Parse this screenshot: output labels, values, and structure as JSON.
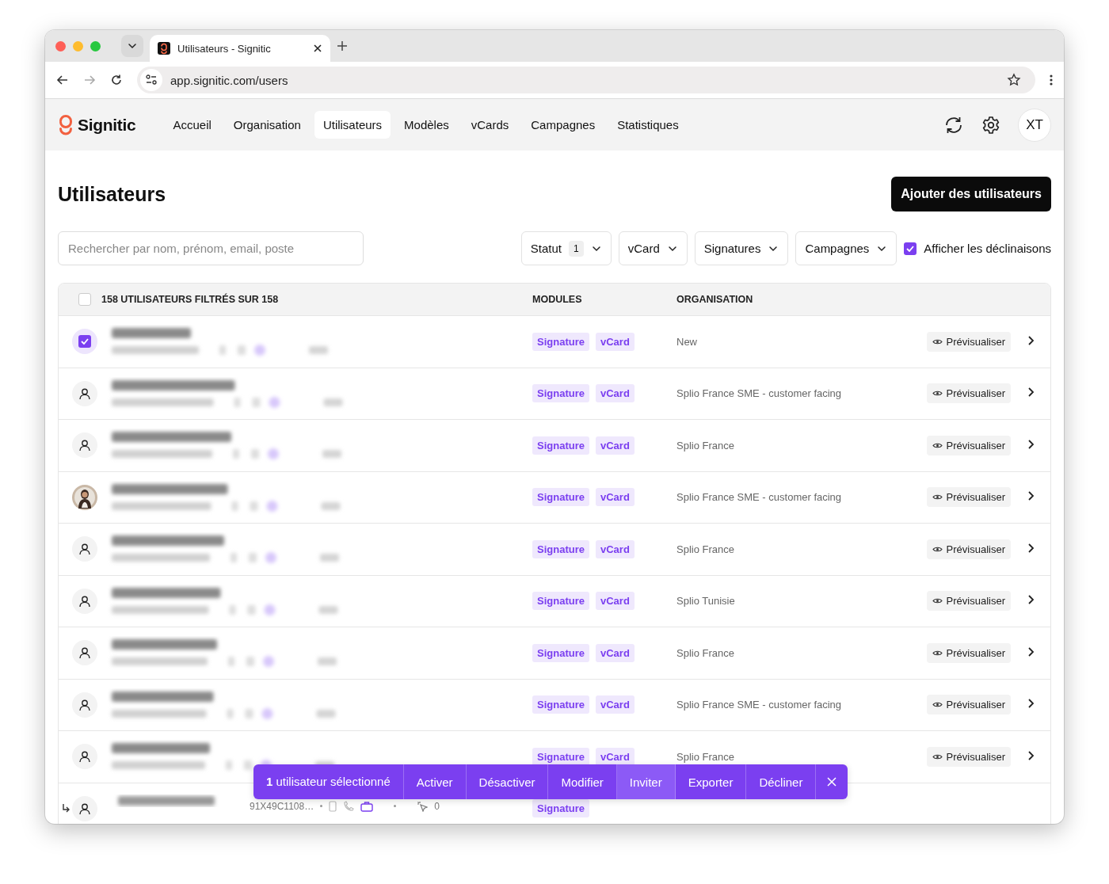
{
  "browser": {
    "tab_title": "Utilisateurs - Signitic",
    "url": "app.signitic.com/users"
  },
  "nav": {
    "brand": "Signitic",
    "items": [
      {
        "label": "Accueil",
        "selected": false
      },
      {
        "label": "Organisation",
        "selected": false
      },
      {
        "label": "Utilisateurs",
        "selected": true
      },
      {
        "label": "Modèles",
        "selected": false
      },
      {
        "label": "vCards",
        "selected": false
      },
      {
        "label": "Campagnes",
        "selected": false
      },
      {
        "label": "Statistiques",
        "selected": false
      }
    ],
    "avatar": "XT"
  },
  "page": {
    "title": "Utilisateurs",
    "add_button": "Ajouter des utilisateurs"
  },
  "search": {
    "placeholder": "Rechercher par nom, prénom, email, poste"
  },
  "filters": [
    {
      "label": "Statut",
      "badge": "1"
    },
    {
      "label": "vCard"
    },
    {
      "label": "Signatures"
    },
    {
      "label": "Campagnes"
    }
  ],
  "variants_toggle": {
    "label": "Afficher les déclinaisons",
    "checked": true
  },
  "table": {
    "select_all_checked": false,
    "columns": [
      "158 UTILISATEURS FILTRÉS SUR 158",
      "MODULES",
      "ORGANISATION"
    ],
    "rows": [
      {
        "kind": "user",
        "selected": true,
        "modules": [
          "Signature",
          "vCard"
        ],
        "organisation": "New",
        "action": "Prévisualiser"
      },
      {
        "kind": "user",
        "selected": false,
        "photo": false,
        "modules": [
          "Signature",
          "vCard"
        ],
        "organisation": "Splio France SME - customer facing",
        "action": "Prévisualiser"
      },
      {
        "kind": "user",
        "selected": false,
        "photo": false,
        "modules": [
          "Signature",
          "vCard"
        ],
        "organisation": "Splio France",
        "action": "Prévisualiser"
      },
      {
        "kind": "user",
        "selected": false,
        "photo": true,
        "modules": [
          "Signature",
          "vCard"
        ],
        "organisation": "Splio France SME - customer facing",
        "action": "Prévisualiser"
      },
      {
        "kind": "user",
        "selected": false,
        "photo": false,
        "modules": [
          "Signature",
          "vCard"
        ],
        "organisation": "Splio France",
        "action": "Prévisualiser"
      },
      {
        "kind": "user",
        "selected": false,
        "photo": false,
        "modules": [
          "Signature",
          "vCard"
        ],
        "organisation": "Splio Tunisie",
        "action": "Prévisualiser"
      },
      {
        "kind": "user",
        "selected": false,
        "photo": false,
        "modules": [
          "Signature",
          "vCard"
        ],
        "organisation": "Splio France",
        "action": "Prévisualiser"
      },
      {
        "kind": "user",
        "selected": false,
        "photo": false,
        "modules": [
          "Signature",
          "vCard"
        ],
        "organisation": "Splio France SME - customer facing",
        "action": "Prévisualiser"
      },
      {
        "kind": "user",
        "selected": false,
        "photo": false,
        "modules": [
          "Signature",
          "vCard"
        ],
        "organisation": "Splio France",
        "action": "Prévisualiser"
      },
      {
        "kind": "variant",
        "selected": false,
        "photo": false,
        "modules": [
          "Signature"
        ],
        "code": "91X49C1108…",
        "count": "0"
      }
    ]
  },
  "bulk_bar": {
    "summary": "**1** utilisateur sélectionné",
    "actions": [
      {
        "label": "Activer",
        "selected": false
      },
      {
        "label": "Désactiver",
        "selected": false
      },
      {
        "label": "Modifier",
        "selected": false
      },
      {
        "label": "Inviter",
        "selected": true
      },
      {
        "label": "Exporter",
        "selected": false
      },
      {
        "label": "Décliner",
        "selected": false
      }
    ]
  }
}
